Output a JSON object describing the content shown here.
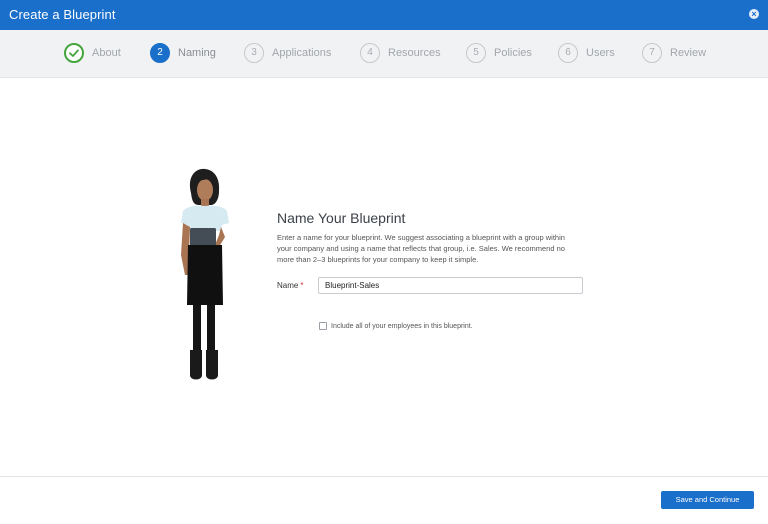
{
  "window": {
    "title": "Create a Blueprint",
    "close_icon": "close-icon"
  },
  "steps": [
    {
      "number": "1",
      "label": "About",
      "state": "done"
    },
    {
      "number": "2",
      "label": "Naming",
      "state": "active"
    },
    {
      "number": "3",
      "label": "Applications",
      "state": "todo"
    },
    {
      "number": "4",
      "label": "Resources",
      "state": "todo"
    },
    {
      "number": "5",
      "label": "Policies",
      "state": "todo"
    },
    {
      "number": "6",
      "label": "Users",
      "state": "todo"
    },
    {
      "number": "7",
      "label": "Review",
      "state": "todo"
    }
  ],
  "main": {
    "heading": "Name Your Blueprint",
    "description": "Enter a name for your blueprint. We suggest associating a blueprint with a group within your company and using a name that reflects that group, i.e. Sales. We recommend no more than 2–3 blueprints for your company to keep it simple.",
    "name_label": "Name",
    "required_mark": "*",
    "name_value": "Blueprint-Sales",
    "include_all_label": "Include all of your employees in this blueprint.",
    "include_all_checked": false
  },
  "footer": {
    "primary_label": "Save and Continue"
  },
  "colors": {
    "accent": "#1a6fcb",
    "success": "#44a53d",
    "required": "#d0342c"
  }
}
